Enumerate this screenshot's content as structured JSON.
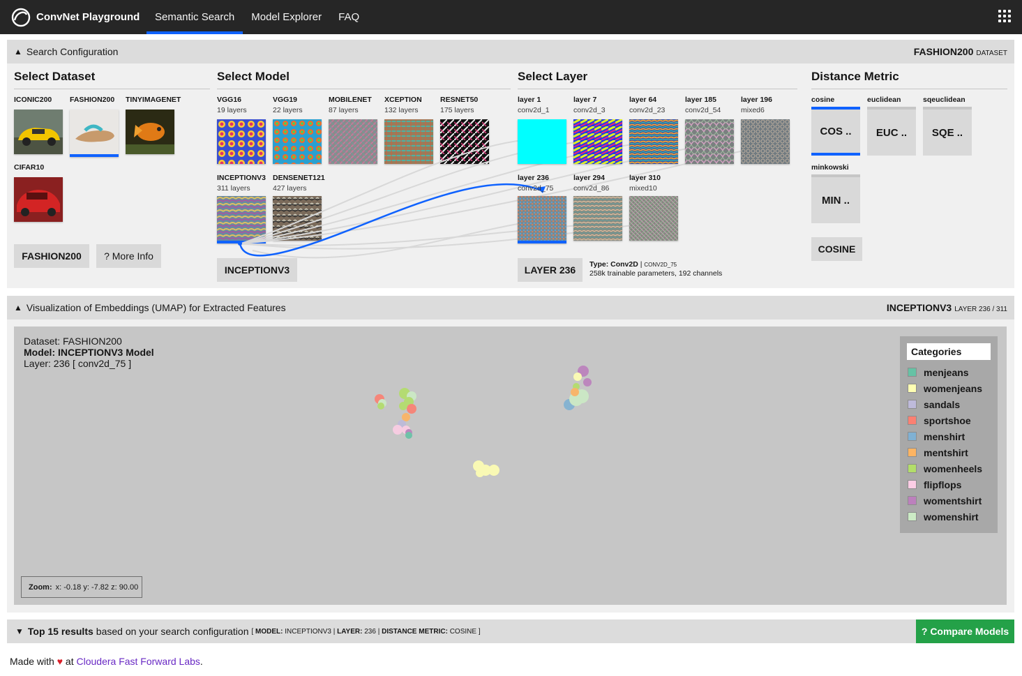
{
  "header": {
    "app_title": "ConvNet Playground",
    "tabs": [
      {
        "label": "Semantic Search",
        "active": true
      },
      {
        "label": "Model Explorer",
        "active": false
      },
      {
        "label": "FAQ",
        "active": false
      }
    ]
  },
  "search_config": {
    "toggle": "▲",
    "title": "Search Configuration",
    "right_value": "FASHION200",
    "right_label": "DATASET",
    "dataset": {
      "title": "Select Dataset",
      "items": [
        {
          "label": "ICONIC200",
          "selected": false
        },
        {
          "label": "FASHION200",
          "selected": true
        },
        {
          "label": "TINYIMAGENET",
          "selected": false
        },
        {
          "label": "CIFAR10",
          "selected": false
        }
      ],
      "selected_button": "FASHION200",
      "more_info": "? More Info"
    },
    "model": {
      "title": "Select Model",
      "items": [
        {
          "label": "VGG16",
          "sub": "19 layers"
        },
        {
          "label": "VGG19",
          "sub": "22 layers"
        },
        {
          "label": "MOBILENET",
          "sub": "87 layers"
        },
        {
          "label": "XCEPTION",
          "sub": "132 layers"
        },
        {
          "label": "RESNET50",
          "sub": "175 layers"
        },
        {
          "label": "INCEPTIONV3",
          "sub": "311 layers"
        },
        {
          "label": "DENSENET121",
          "sub": "427 layers"
        }
      ],
      "selected_button": "INCEPTIONV3"
    },
    "layer": {
      "title": "Select Layer",
      "items": [
        {
          "label": "layer 1",
          "sub": "conv2d_1"
        },
        {
          "label": "layer 7",
          "sub": "conv2d_3"
        },
        {
          "label": "layer 64",
          "sub": "conv2d_23"
        },
        {
          "label": "layer 185",
          "sub": "conv2d_54"
        },
        {
          "label": "layer 196",
          "sub": "mixed6"
        },
        {
          "label": "layer 236",
          "sub": "conv2d_75"
        },
        {
          "label": "layer 294",
          "sub": "conv2d_86"
        },
        {
          "label": "layer 310",
          "sub": "mixed10"
        }
      ],
      "selected_button": "LAYER 236",
      "type_label": "Type: Conv2D",
      "type_sep": "|",
      "type_name": "CONV2D_75",
      "params": "258k trainable parameters, 192 channels"
    },
    "metric": {
      "title": "Distance Metric",
      "items": [
        {
          "label": "cosine",
          "box": "COS ..",
          "selected": true
        },
        {
          "label": "euclidean",
          "box": "EUC ..",
          "selected": false
        },
        {
          "label": "sqeuclidean",
          "box": "SQE ..",
          "selected": false
        },
        {
          "label": "minkowski",
          "box": "MIN ..",
          "selected": false
        }
      ],
      "selected_button": "COSINE"
    }
  },
  "visualization": {
    "toggle": "▲",
    "title": "Visualization of Embeddings (UMAP) for Extracted Features",
    "right_value": "INCEPTIONV3",
    "right_label": "LAYER 236 / 311",
    "info_dataset": "Dataset: FASHION200",
    "info_model": "Model: INCEPTIONV3 Model",
    "info_layer": "Layer: 236 [ conv2d_75 ]",
    "legend_title": "Categories",
    "categories": [
      {
        "name": "menjeans",
        "color": "#66c2a5"
      },
      {
        "name": "womenjeans",
        "color": "#ffffb3"
      },
      {
        "name": "sandals",
        "color": "#bebada"
      },
      {
        "name": "sportshoe",
        "color": "#fb8072"
      },
      {
        "name": "menshirt",
        "color": "#80b1d3"
      },
      {
        "name": "mentshirt",
        "color": "#fdb462"
      },
      {
        "name": "womenheels",
        "color": "#b3de69"
      },
      {
        "name": "flipflops",
        "color": "#fccde5"
      },
      {
        "name": "womentshirt",
        "color": "#bc80bd"
      },
      {
        "name": "womenshirt",
        "color": "#ccebc5"
      }
    ],
    "zoom_label": "Zoom:",
    "zoom_value": "x: -0.18 y: -7.82 z: 90.00"
  },
  "results": {
    "toggle": "▼",
    "count_label": "Top 15 results",
    "text": "based on your search configuration",
    "open": "[",
    "model_key": "MODEL:",
    "model_val": "INCEPTIONV3",
    "sep": "|",
    "layer_key": "LAYER:",
    "layer_val": "236",
    "metric_key": "DISTANCE METRIC:",
    "metric_val": "COSINE",
    "close": "]",
    "compare": "? Compare Models"
  },
  "footer": {
    "prefix": "Made with",
    "heart": "♥",
    "at": "at",
    "link": "Cloudera Fast Forward Labs",
    "suffix": "."
  }
}
